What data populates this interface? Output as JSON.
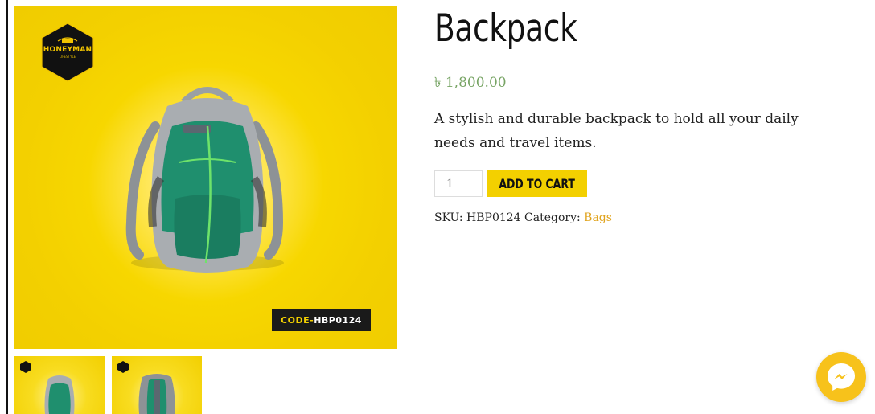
{
  "product": {
    "title": "Backpack",
    "price": "৳ 1,800.00",
    "description": "A stylish and durable backpack to hold all your daily needs and travel items.",
    "quantity": "1",
    "add_to_cart_label": "ADD TO CART",
    "sku_label": "SKU:",
    "sku_value": "HBP0124",
    "category_label": "Category:",
    "category_value": "Bags"
  },
  "image": {
    "logo_text": "HONEYMAN",
    "logo_subtext": "LIFESTYLE",
    "code_prefix": "CODE",
    "code_value": "HBP0124"
  },
  "colors": {
    "accent": "#f3d000",
    "price": "#77a464",
    "category_link": "#e0a31c",
    "backpack_green": "#1f8f6e"
  },
  "icons": {
    "messenger": "messenger-icon"
  }
}
